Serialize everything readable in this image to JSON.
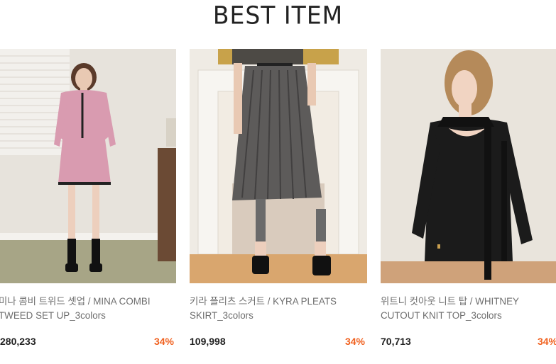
{
  "section": {
    "title": "BEST ITEM"
  },
  "products": [
    {
      "name_line1": "미나 콤비 트위드 셋업 / MINA COMBI",
      "name_line2": "TWEED SET UP_3colors",
      "price": "280,233",
      "discount": "34%"
    },
    {
      "name_line1": "키라 플리츠 스커트 / KYRA PLEATS",
      "name_line2": "SKIRT_3colors",
      "price": "109,998",
      "discount": "34%"
    },
    {
      "name_line1": "위트니 컷아웃 니트 탑 / WHITNEY",
      "name_line2": "CUTOUT KNIT TOP_3colors",
      "price": "70,713",
      "discount": "34%"
    }
  ],
  "colors": {
    "discount": "#f0601e",
    "price": "#222222",
    "name": "#6e6e6e"
  }
}
